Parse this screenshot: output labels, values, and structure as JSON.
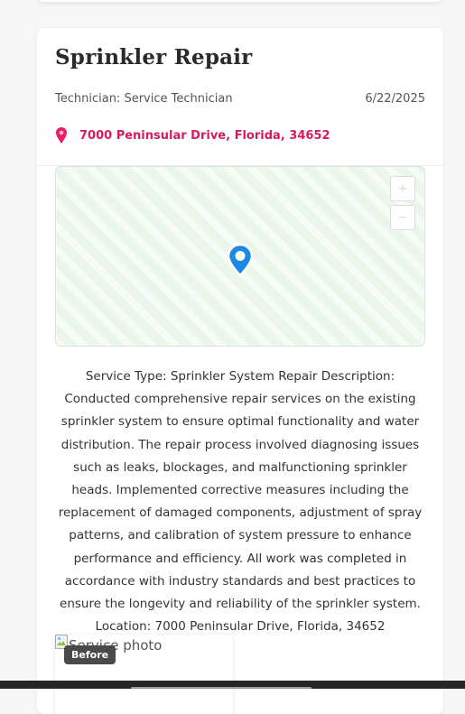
{
  "job": {
    "title": "Sprinkler Repair",
    "technician": "Technician: Service Technician",
    "date": "6/22/2025",
    "address": "7000 Peninsular Drive, Florida, 34652"
  },
  "map": {
    "zoom_in_label": "+",
    "zoom_out_label": "−",
    "pin_color": "#1e88e5"
  },
  "description": "Service Type: Sprinkler System Repair Description: Conducted comprehensive repair services on the existing sprinkler system to ensure optimal functionality and water distribution. The repair process involved diagnosing issues such as leaks, blockages, and malfunctioning sprinkler heads. Implemented corrective measures including the replacement of damaged components, adjustment of spray patterns, and calibration of system pressure to enhance performance and efficiency. All work was completed in accordance with industry standards and best practices to ensure the longevity and reliability of the sprinkler system. Location: 7000 Peninsular Drive, Florida, 34652",
  "photo": {
    "alt": "Service photo",
    "badge": "Before"
  },
  "colors": {
    "accent": "#d81b60",
    "map_bg": "#eaf6ea",
    "pin": "#1e88e5"
  }
}
